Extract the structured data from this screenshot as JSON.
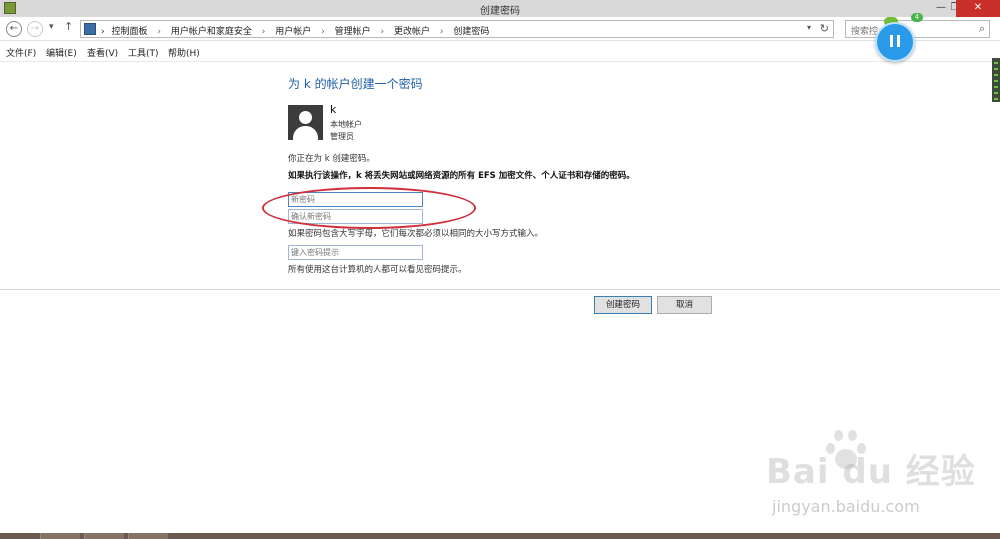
{
  "window": {
    "title": "创建密码",
    "controls": {
      "minimize": "—",
      "restore": "❐",
      "close": "✕"
    }
  },
  "nav": {
    "back_icon": "←",
    "forward_icon": "→",
    "dropdown_icon": "▾",
    "up_icon": "↑",
    "breadcrumb": [
      "控制面板",
      "用户帐户和家庭安全",
      "用户帐户",
      "管理帐户",
      "更改帐户",
      "创建密码"
    ],
    "separator": "›",
    "address_dropdown_icon": "▾",
    "refresh_icon": "↻",
    "search_placeholder": "搜索控",
    "search_icon": "⌕"
  },
  "menu": [
    "文件(F)",
    "编辑(E)",
    "查看(V)",
    "工具(T)",
    "帮助(H)"
  ],
  "page": {
    "heading": "为 k 的帐户创建一个密码",
    "user": {
      "name": "k",
      "type": "本地帐户",
      "role": "管理员"
    },
    "intro": "你正在为 k 创建密码。",
    "warning": "如果执行该操作，k 将丢失网站或网络资源的所有 EFS 加密文件、个人证书和存储的密码。",
    "new_password_placeholder": "新密码",
    "confirm_password_placeholder": "确认新密码",
    "case_hint": "如果密码包含大写字母，它们每次都必须以相同的大小写方式输入。",
    "password_hint_placeholder": "键入密码提示",
    "visibility_note": "所有使用这台计算机的人都可以看见密码提示。"
  },
  "buttons": {
    "create": "创建密码",
    "cancel": "取消"
  },
  "overlay": {
    "badge_count": "4"
  },
  "watermark": {
    "logo": "Bai du 经验",
    "url": "jingyan.baidu.com"
  },
  "colors": {
    "heading": "#1e5fa8",
    "annotation_oval": "#d0303a",
    "close_button": "#c9302c"
  }
}
